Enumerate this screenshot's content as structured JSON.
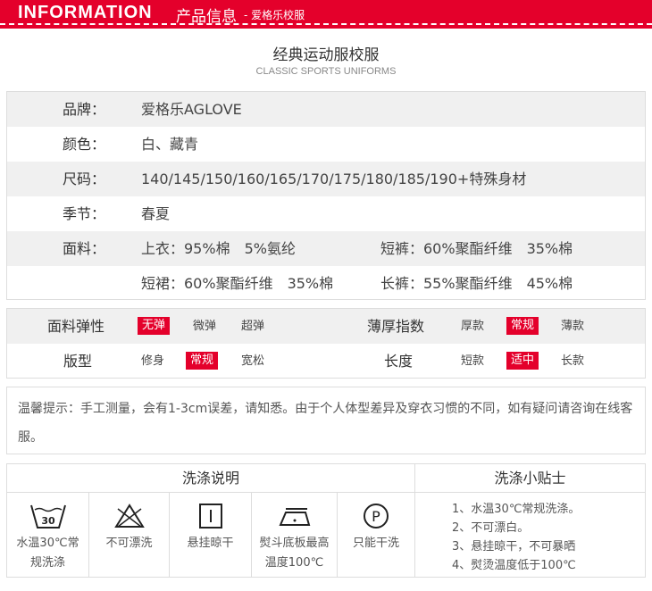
{
  "header": {
    "en": "INFORMATION",
    "cn": "产品信息",
    "sub": "- 爱格乐校服"
  },
  "title": "经典运动服校服",
  "subtitle": "CLASSIC SPORTS UNIFORMS",
  "info": [
    {
      "label": "品牌：",
      "value": "爱格乐AGLOVE"
    },
    {
      "label": "颜色：",
      "value": "白、藏青"
    },
    {
      "label": "尺码：",
      "value": "140/145/150/160/165/170/175/180/185/190+特殊身材"
    },
    {
      "label": "季节：",
      "value": "春夏"
    },
    {
      "label": "面料：",
      "value": "上衣：95%棉　5%氨纶",
      "value2": "短裤：60%聚酯纤维　35%棉"
    },
    {
      "label": "",
      "value": "短裙：60%聚酯纤维　35%棉",
      "value2": "长裤：55%聚酯纤维　45%棉"
    }
  ],
  "attributes": {
    "elasticity": {
      "label": "面料弹性",
      "options": [
        "无弹",
        "微弹",
        "超弹"
      ],
      "selected": "无弹"
    },
    "thickness": {
      "label": "薄厚指数",
      "options": [
        "厚款",
        "常规",
        "薄款"
      ],
      "selected": "常规"
    },
    "fit": {
      "label": "版型",
      "options": [
        "修身",
        "常规",
        "宽松"
      ],
      "selected": "常规"
    },
    "length": {
      "label": "长度",
      "options": [
        "短款",
        "适中",
        "长款"
      ],
      "selected": "适中"
    }
  },
  "note": "温馨提示：手工测量，会有1-3cm误差，请知悉。由于个人体型差异及穿衣习惯的不同，如有疑问请咨询在线客服。",
  "wash": {
    "title": "洗涤说明",
    "items": [
      {
        "icon": "wash-30-icon",
        "label": "水温30℃常规洗涤",
        "num": "30"
      },
      {
        "icon": "no-bleach-icon",
        "label": "不可漂洗"
      },
      {
        "icon": "hang-dry-icon",
        "label": "悬挂晾干"
      },
      {
        "icon": "iron-icon",
        "label": "熨斗底板最高温度100℃"
      },
      {
        "icon": "dry-clean-icon",
        "label": "只能干洗",
        "letter": "P"
      }
    ]
  },
  "tips": {
    "title": "洗涤小贴士",
    "items": [
      "1、水温30℃常规洗涤。",
      "2、不可漂白。",
      "3、悬挂晾干，不可暴晒",
      "4、熨烫温度低于100℃"
    ]
  },
  "colors": {
    "accent": "#e4002b"
  }
}
